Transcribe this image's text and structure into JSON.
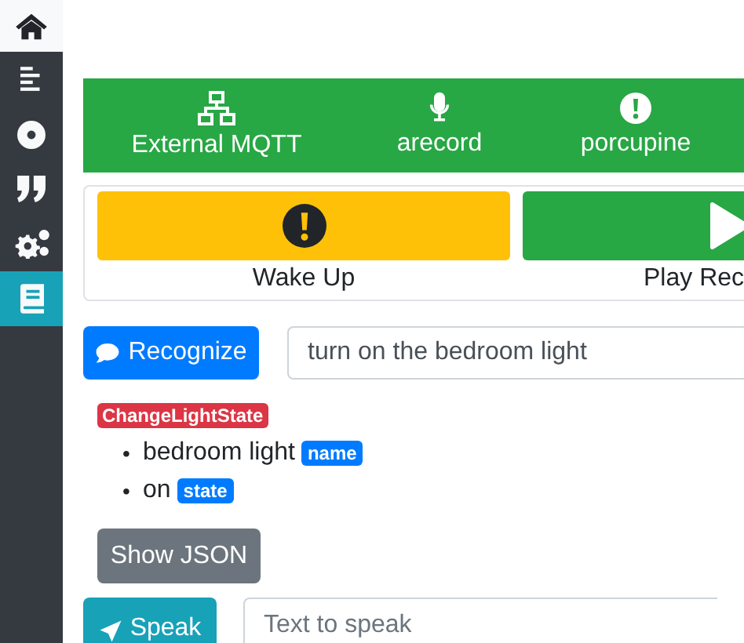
{
  "sidebar": {
    "items": [
      {
        "selected": false
      },
      {
        "selected": false
      },
      {
        "selected": false
      },
      {
        "selected": false
      },
      {
        "selected": true
      }
    ]
  },
  "status_bar": {
    "items": [
      {
        "label": "External MQTT"
      },
      {
        "label": "arecord"
      },
      {
        "label": "porcupine"
      }
    ]
  },
  "actions": [
    {
      "label": "Wake Up",
      "kind": "warning"
    },
    {
      "label": "Play Rec",
      "kind": "success"
    }
  ],
  "recognize": {
    "button": "Recognize",
    "value": "turn on the bedroom light"
  },
  "intent": {
    "name": "ChangeLightState",
    "slots": [
      {
        "marker": "•",
        "value": "bedroom light",
        "slot": "name"
      },
      {
        "marker": "•",
        "value": "on",
        "slot": "state"
      }
    ]
  },
  "show_json": "Show JSON",
  "speak": {
    "button": "Speak",
    "placeholder": "Text to speak"
  }
}
